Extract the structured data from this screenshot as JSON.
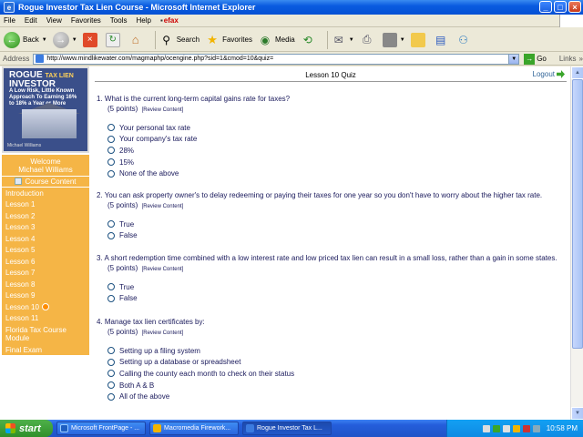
{
  "window": {
    "title": "Rogue Investor Tax Lien Course - Microsoft Internet Explorer"
  },
  "menu": [
    "File",
    "Edit",
    "View",
    "Favorites",
    "Tools",
    "Help"
  ],
  "menu_efax": "efax",
  "toolbar": {
    "back": "Back",
    "search": "Search",
    "favorites": "Favorites",
    "media": "Media"
  },
  "address": {
    "label": "Address",
    "url": "http://www.mindlikewater.com/magmaphp/ocengine.php?sid=1&cmod=10&quiz=",
    "go": "Go",
    "links": "Links"
  },
  "sidebar": {
    "book": {
      "title_a": "ROGUE",
      "title_b": "TAX LIEN",
      "title_c": "INVESTOR",
      "subtitle": "A Low Risk, Little Known Approach To Earning 16% to 18% a Year or More",
      "author": "Michael Williams"
    },
    "welcome": "Welcome",
    "user": "Michael Williams",
    "course_content": "Course Content",
    "items": [
      "Introduction",
      "Lesson 1",
      "Lesson 2",
      "Lesson 3",
      "Lesson 4",
      "Lesson 5",
      "Lesson 6",
      "Lesson 7",
      "Lesson 8",
      "Lesson 9",
      "Lesson 10",
      "Lesson 11",
      "Florida Tax Course Module",
      "Final Exam"
    ]
  },
  "quiz": {
    "title": "Lesson 10 Quiz",
    "logout": "Logout",
    "review": "[Review Content]",
    "questions": [
      {
        "text": "1. What is the current long-term capital gains rate for taxes?",
        "points": "(5 points)",
        "options": [
          "Your personal tax rate",
          "Your company's tax rate",
          "28%",
          "15%",
          "None of the above"
        ]
      },
      {
        "text": "2. You can ask property owner's to delay redeeming or paying their taxes for one year so you don't have to worry about the higher tax rate.",
        "points": "(5 points)",
        "options": [
          "True",
          "False"
        ]
      },
      {
        "text": "3. A short redemption time combined with a low interest rate and low priced tax lien can result in a small loss, rather than a gain in some states.",
        "points": "(5 points)",
        "options": [
          "True",
          "False"
        ]
      },
      {
        "text": "4. Manage tax lien certificates by:",
        "points": "(5 points)",
        "options": [
          "Setting up a filing system",
          "Setting up a database or spreadsheet",
          "Calling the county each month to check on their status",
          "Both A & B",
          "All of the above"
        ]
      }
    ]
  },
  "taskbar": {
    "start": "start",
    "tasks": [
      "Microsoft FrontPage - ...",
      "Macromedia Firework...",
      "Rogue Investor Tax L..."
    ],
    "clock": "10:58 PM"
  }
}
